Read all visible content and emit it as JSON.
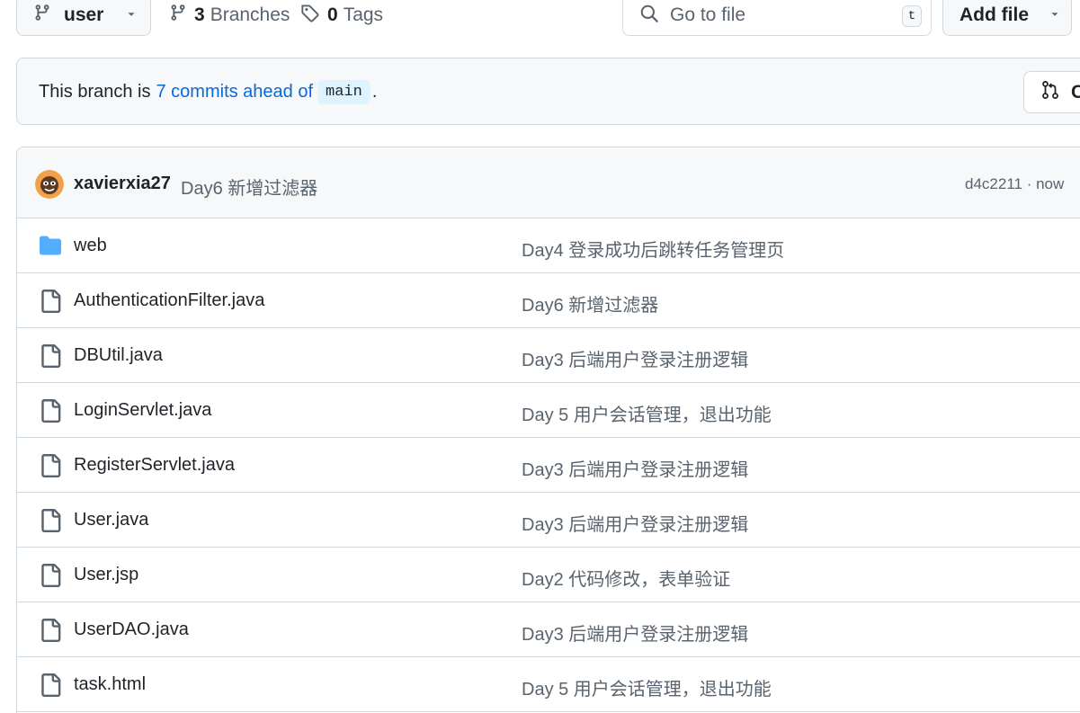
{
  "toolbar": {
    "branch_name": "user",
    "branches_count": "3",
    "branches_label": "Branches",
    "tags_count": "0",
    "tags_label": "Tags",
    "search_placeholder": "Go to file",
    "search_shortcut": "t",
    "add_file_label": "Add file"
  },
  "ahead_banner": {
    "prefix": "This branch is",
    "link_text": "7 commits ahead of",
    "base_branch": "main",
    "suffix": ".",
    "button_label_visible": "C"
  },
  "latest_commit": {
    "author": "xavierxia27",
    "message": "Day6 新增过滤器",
    "meta": "d4c2211 · now"
  },
  "files": [
    {
      "type": "folder",
      "name": "web",
      "message": "Day4 登录成功后跳转任务管理页"
    },
    {
      "type": "file",
      "name": "AuthenticationFilter.java",
      "message": "Day6 新增过滤器"
    },
    {
      "type": "file",
      "name": "DBUtil.java",
      "message": "Day3 后端用户登录注册逻辑"
    },
    {
      "type": "file",
      "name": "LoginServlet.java",
      "message": "Day 5 用户会话管理，退出功能"
    },
    {
      "type": "file",
      "name": "RegisterServlet.java",
      "message": "Day3 后端用户登录注册逻辑"
    },
    {
      "type": "file",
      "name": "User.java",
      "message": "Day3 后端用户登录注册逻辑"
    },
    {
      "type": "file",
      "name": "User.jsp",
      "message": "Day2 代码修改，表单验证"
    },
    {
      "type": "file",
      "name": "UserDAO.java",
      "message": "Day3 后端用户登录注册逻辑"
    },
    {
      "type": "file",
      "name": "task.html",
      "message": "Day 5 用户会话管理，退出功能"
    }
  ],
  "colors": {
    "link": "#0969da",
    "folder": "#54aeff",
    "muted": "#59636e",
    "border": "#d1d9e0",
    "subtle_bg": "#f6f8fa"
  }
}
